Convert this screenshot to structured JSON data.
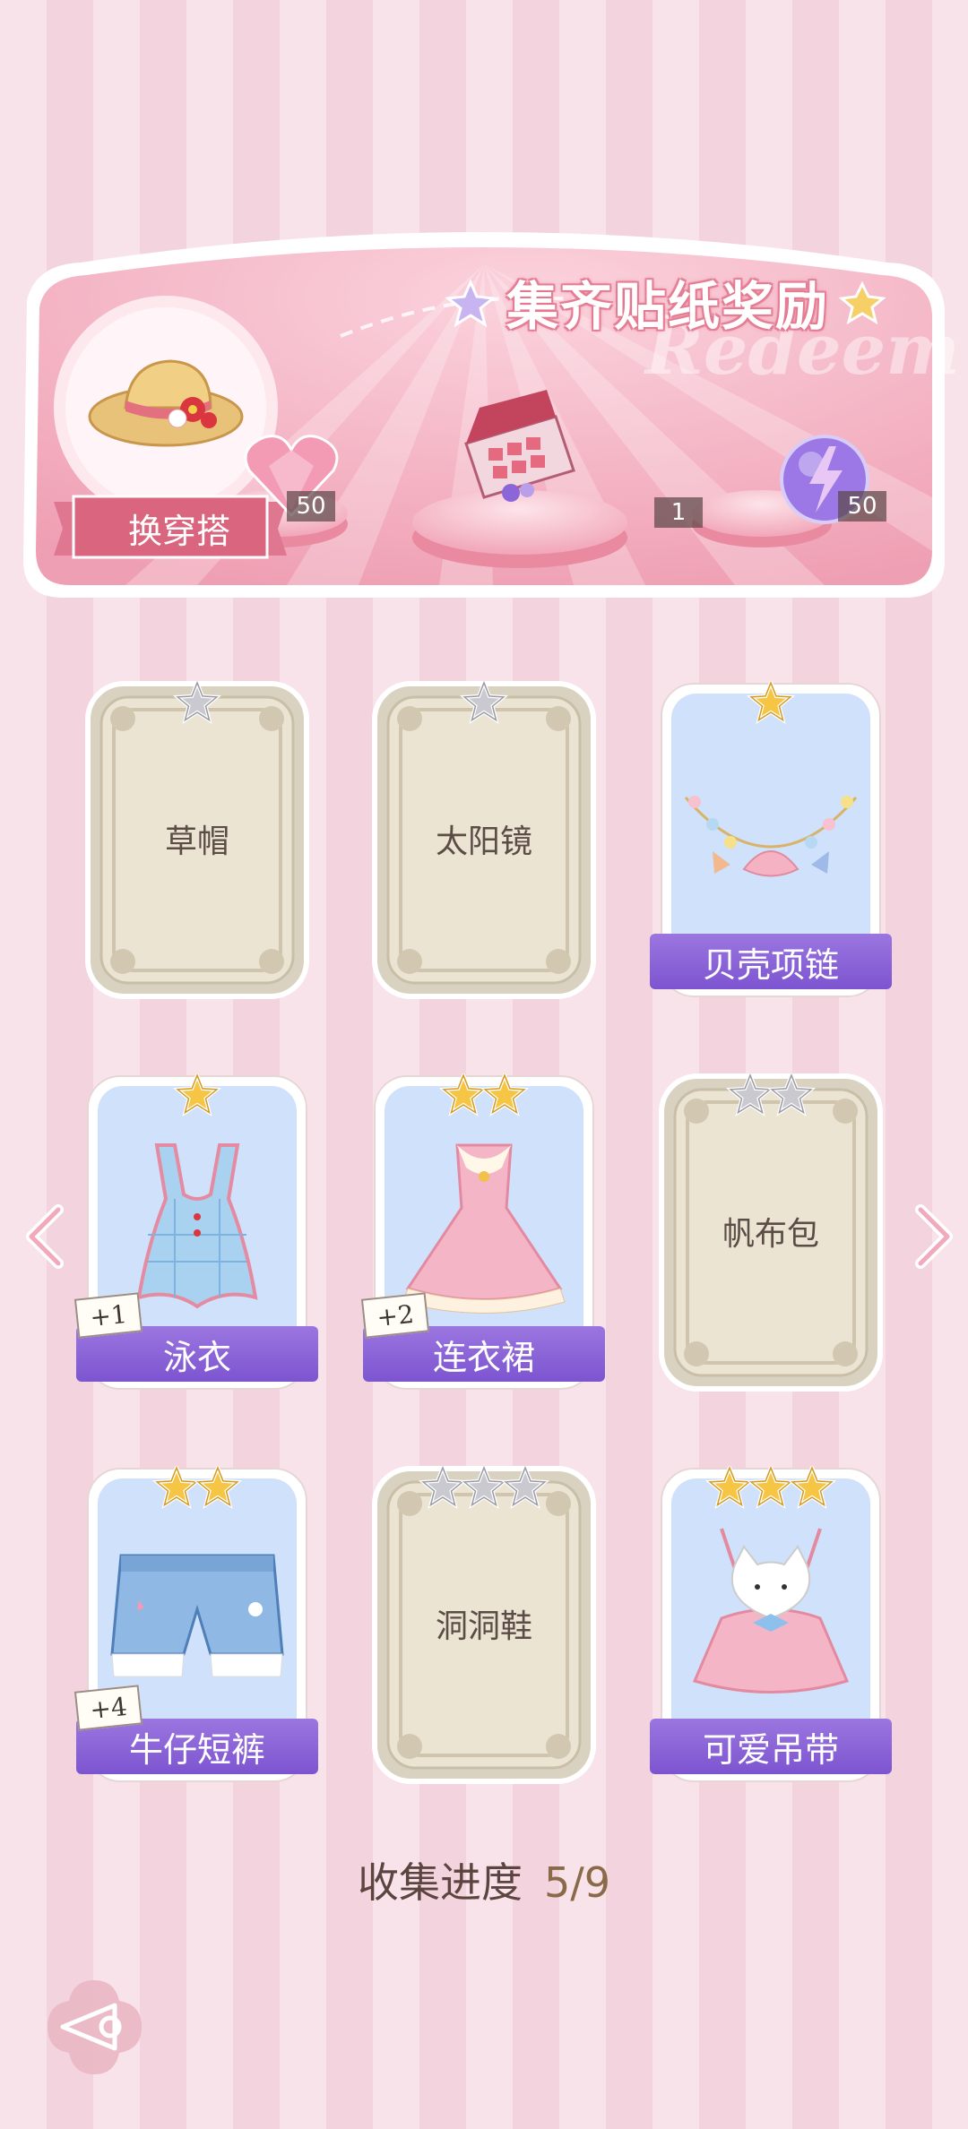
{
  "banner": {
    "title": "集齐贴纸奖励",
    "watermark": "Redeem",
    "outfit_button": "换穿搭",
    "rewards": [
      {
        "icon": "pink-heart-gem-icon",
        "count": "50"
      },
      {
        "icon": "gift-box-icon",
        "count": "1"
      },
      {
        "icon": "purple-lightning-orb-icon",
        "count": "50"
      }
    ]
  },
  "cards": [
    {
      "label": "草帽",
      "stars": 1,
      "star_color": "silver",
      "collected": false,
      "plus": ""
    },
    {
      "label": "太阳镜",
      "stars": 1,
      "star_color": "silver",
      "collected": false,
      "plus": ""
    },
    {
      "label": "贝壳项链",
      "stars": 1,
      "star_color": "gold",
      "collected": true,
      "plus": "",
      "icon": "shell-necklace-icon"
    },
    {
      "label": "泳衣",
      "stars": 1,
      "star_color": "gold",
      "collected": true,
      "plus": "+1",
      "icon": "swimsuit-icon"
    },
    {
      "label": "连衣裙",
      "stars": 2,
      "star_color": "gold",
      "collected": true,
      "plus": "+2",
      "icon": "dress-icon"
    },
    {
      "label": "帆布包",
      "stars": 2,
      "star_color": "silver",
      "collected": false,
      "plus": ""
    },
    {
      "label": "牛仔短裤",
      "stars": 2,
      "star_color": "gold",
      "collected": true,
      "plus": "+4",
      "icon": "denim-shorts-icon"
    },
    {
      "label": "洞洞鞋",
      "stars": 3,
      "star_color": "silver",
      "collected": false,
      "plus": ""
    },
    {
      "label": "可爱吊带",
      "stars": 3,
      "star_color": "gold",
      "collected": true,
      "plus": "",
      "icon": "cat-camisole-icon"
    }
  ],
  "progress": {
    "label": "收集进度",
    "value": "5/9"
  },
  "nav": {
    "prev_icon": "chevron-left-icon",
    "next_icon": "chevron-right-icon",
    "back_icon": "back-icon"
  },
  "colors": {
    "ribbon": "#8a60d6",
    "gold_star": "#f5c543",
    "silver_star": "#c9c9cf",
    "collected_bg": "#cfe1fb",
    "card_plain": "#ece4d3"
  }
}
